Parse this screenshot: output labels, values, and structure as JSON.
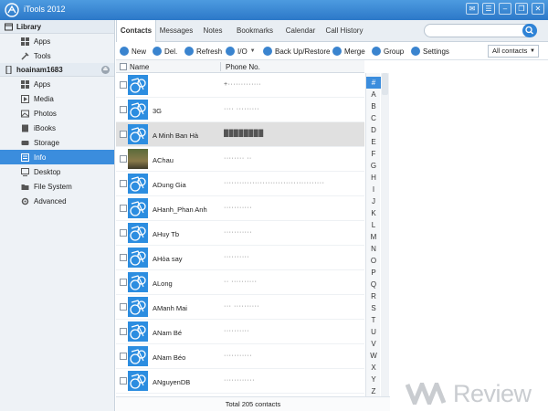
{
  "app": {
    "title": "iTools 2012"
  },
  "window_controls": [
    "feedback-icon",
    "menu-icon",
    "minimize-icon",
    "restore-icon",
    "close-icon"
  ],
  "sidebar": {
    "library": {
      "label": "Library",
      "items": [
        {
          "label": "Apps",
          "icon": "apps-icon"
        },
        {
          "label": "Tools",
          "icon": "tools-icon"
        }
      ]
    },
    "device": {
      "label": "hoainam1683",
      "items": [
        {
          "label": "Apps",
          "icon": "apps-icon"
        },
        {
          "label": "Media",
          "icon": "media-icon"
        },
        {
          "label": "Photos",
          "icon": "photos-icon"
        },
        {
          "label": "iBooks",
          "icon": "ibooks-icon"
        },
        {
          "label": "Storage",
          "icon": "storage-icon"
        },
        {
          "label": "Info",
          "icon": "info-icon",
          "active": true
        },
        {
          "label": "Desktop",
          "icon": "desktop-icon"
        },
        {
          "label": "File System",
          "icon": "folder-icon"
        },
        {
          "label": "Advanced",
          "icon": "advanced-icon"
        }
      ]
    }
  },
  "tabs": [
    {
      "label": "Contacts",
      "active": true
    },
    {
      "label": "Messages"
    },
    {
      "label": "Notes"
    },
    {
      "label": "Bookmarks"
    },
    {
      "label": "Calendar"
    },
    {
      "label": "Call History"
    }
  ],
  "search": {
    "placeholder": ""
  },
  "toolbar": {
    "new": "New",
    "delete": "Del.",
    "refresh": "Refresh",
    "io": "I/O",
    "backup": "Back Up/Restore",
    "merge": "Merge",
    "group": "Group",
    "settings": "Settings",
    "filter": "All contacts"
  },
  "table": {
    "columns": {
      "name": "Name",
      "phone": "Phone No."
    },
    "rows": [
      {
        "name": "",
        "phone": "+·············"
      },
      {
        "name": "3G",
        "phone": "···· ·········"
      },
      {
        "name": "A Minh Ban Hà",
        "phone": "████████",
        "selected": true
      },
      {
        "name": "AChau",
        "phone": "········ ··"
      },
      {
        "name": "ADung Gia",
        "phone": "·······································"
      },
      {
        "name": "AHanh_Phan Anh",
        "phone": "···········"
      },
      {
        "name": "AHuy Tb",
        "phone": "···········"
      },
      {
        "name": "AHòa say",
        "phone": "··········"
      },
      {
        "name": "ALong",
        "phone": "·· ··········"
      },
      {
        "name": "AManh Mai",
        "phone": "··· ··········"
      },
      {
        "name": "ANam Bé",
        "phone": "··········"
      },
      {
        "name": "ANam Béo",
        "phone": "···········"
      },
      {
        "name": "ANguyenDB",
        "phone": "············"
      }
    ],
    "footer": "Total 205 contacts"
  },
  "alpha_index": [
    "#",
    "A",
    "B",
    "C",
    "D",
    "E",
    "F",
    "G",
    "H",
    "I",
    "J",
    "K",
    "L",
    "M",
    "N",
    "O",
    "P",
    "Q",
    "R",
    "S",
    "T",
    "U",
    "V",
    "W",
    "X",
    "Y",
    "Z"
  ],
  "watermark": {
    "text": "Review"
  },
  "colors": {
    "accent": "#3b8ddd",
    "titlebar": "#3a88d6",
    "selected_row": "#e0e0e0"
  }
}
